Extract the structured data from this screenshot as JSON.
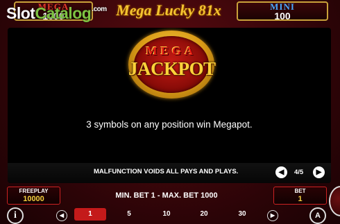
{
  "jackpots": {
    "mega": {
      "label": "MEGA",
      "value": "1000"
    },
    "mini": {
      "label": "MINI",
      "value": "100"
    }
  },
  "game_title": "Mega Lucky 81x",
  "watermark": {
    "slot": "Slot",
    "catalog": "Catalog",
    "com": ".com"
  },
  "paytable": {
    "logo": {
      "line1": "MEGA",
      "line2": "JACKPOT"
    },
    "rule": "3 symbols on any position win Megapot.",
    "disclaimer": "MALFUNCTION VOIDS ALL PAYS AND PLAYS.",
    "page_indicator": "4/5",
    "prev_icon": "◀",
    "next_icon": "▶"
  },
  "freeplay": {
    "label": "FREEPLAY",
    "value": "10000"
  },
  "bet_limits": "MIN. BET 1 - MAX. BET 1000",
  "bet": {
    "label": "BET",
    "value": "1"
  },
  "bet_options": [
    "1",
    "5",
    "10",
    "20",
    "30"
  ],
  "selected_bet_index": 0,
  "controls": {
    "info_icon": "i",
    "autoplay_icon": "A",
    "left_icon": "◀",
    "right_icon": "▶"
  },
  "colors": {
    "accent_red": "#c41a1a",
    "gold": "#f4c430",
    "mini_blue": "#4aa8ff"
  }
}
